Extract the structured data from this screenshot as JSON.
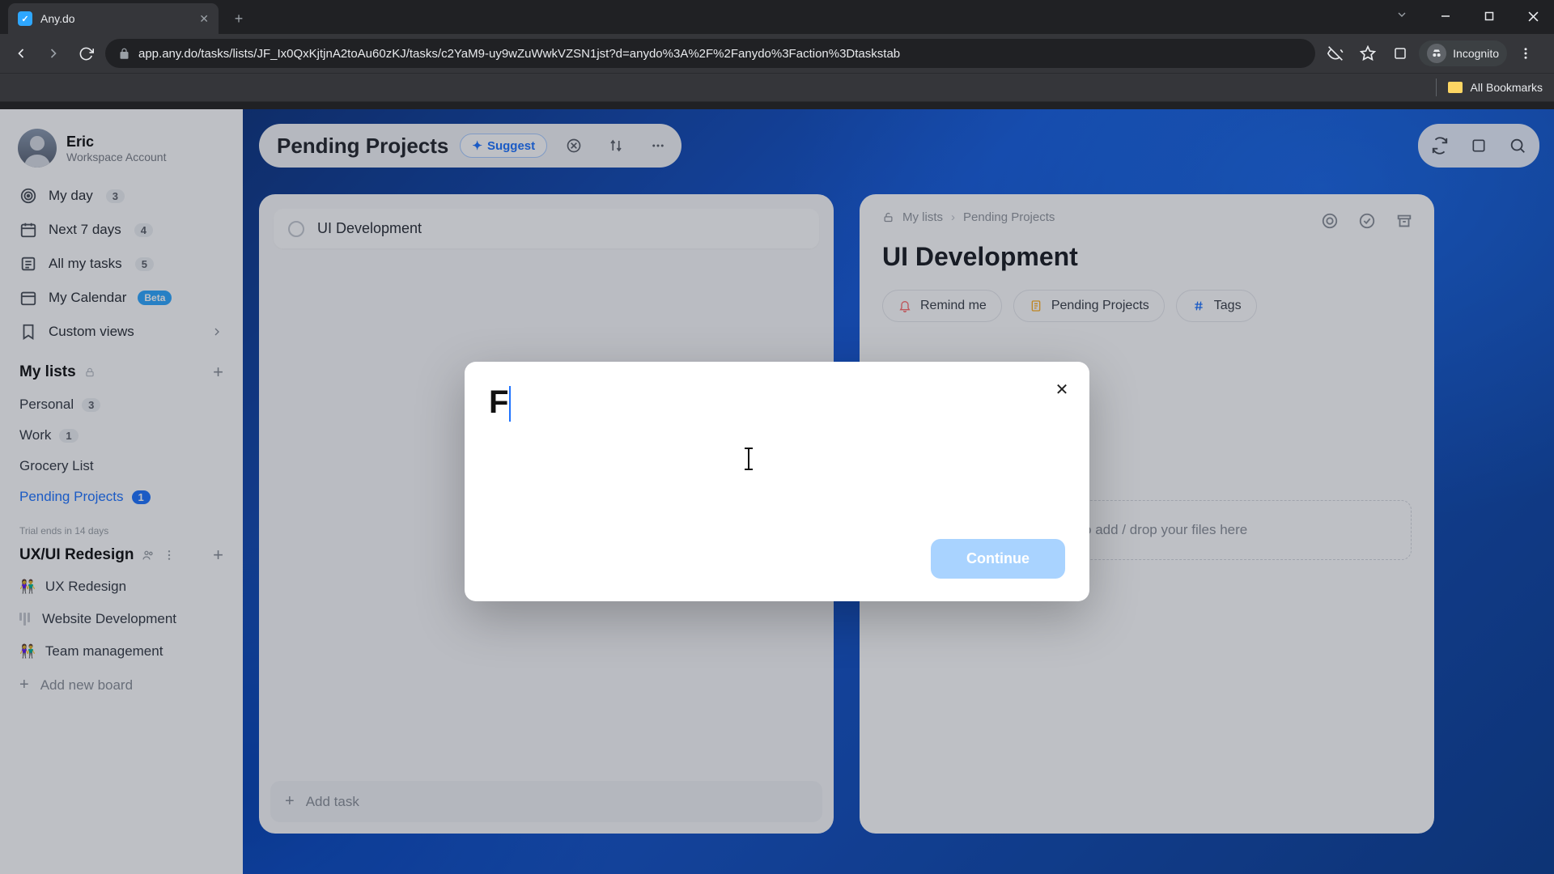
{
  "browser": {
    "tab_title": "Any.do",
    "url": "app.any.do/tasks/lists/JF_Ix0QxKjtjnA2toAu60zKJ/tasks/c2YaM9-uy9wZuWwkVZSN1jst?d=anydo%3A%2F%2Fanydo%3Faction%3Dtaskstab",
    "incognito_label": "Incognito",
    "all_bookmarks": "All Bookmarks"
  },
  "user": {
    "name": "Eric",
    "subtitle": "Workspace Account"
  },
  "sidebar": {
    "items": [
      {
        "label": "My day",
        "count": "3"
      },
      {
        "label": "Next 7 days",
        "count": "4"
      },
      {
        "label": "All my tasks",
        "count": "5"
      },
      {
        "label": "My Calendar",
        "badge": "Beta"
      },
      {
        "label": "Custom views"
      }
    ],
    "lists_header": "My lists",
    "lists": [
      {
        "label": "Personal",
        "count": "3"
      },
      {
        "label": "Work",
        "count": "1"
      },
      {
        "label": "Grocery List"
      },
      {
        "label": "Pending Projects",
        "count": "1"
      }
    ],
    "trial_note": "Trial ends in 14 days",
    "board_group": "UX/UI Redesign",
    "boards": [
      {
        "label": "UX Redesign"
      },
      {
        "label": "Website Development"
      },
      {
        "label": "Team management"
      }
    ],
    "add_board": "Add new board"
  },
  "header": {
    "title": "Pending Projects",
    "suggest": "Suggest"
  },
  "task_list": {
    "tasks": [
      {
        "title": "UI Development"
      }
    ],
    "add_task": "Add task"
  },
  "detail": {
    "crumb1": "My lists",
    "crumb2": "Pending Projects",
    "title": "UI Development",
    "chips": {
      "remind": "Remind me",
      "list": "Pending Projects",
      "tags": "Tags"
    },
    "attach_placeholder": "Click to add / drop your files here"
  },
  "modal": {
    "input_value": "F",
    "continue": "Continue"
  }
}
